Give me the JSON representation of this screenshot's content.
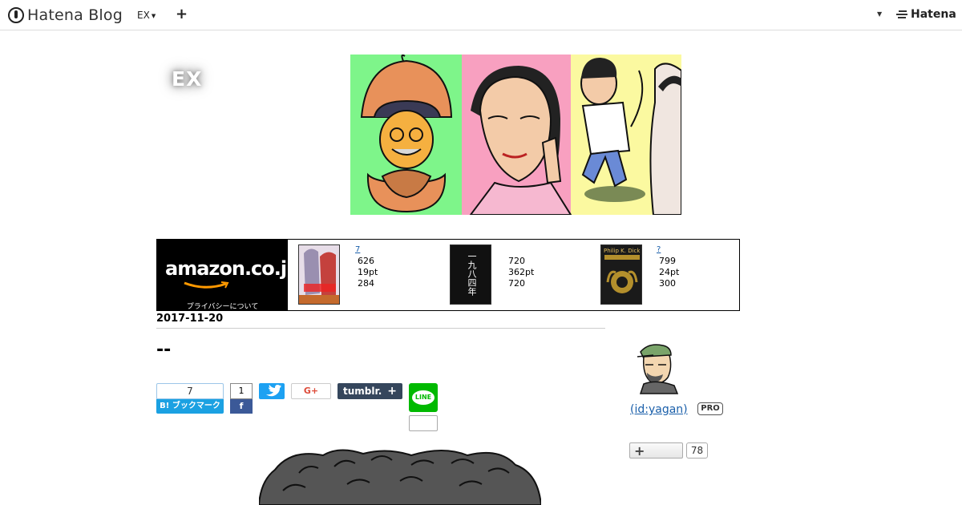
{
  "global_header": {
    "logo_text": "Hatena Blog",
    "blog_selector_label": "EX",
    "new_entry_label": "+",
    "right_menu_caret": "▾",
    "hatena_logo_text": "Hatena"
  },
  "blog": {
    "title": "EX"
  },
  "amazon_widget": {
    "logo_text": "amazon.co.jp",
    "privacy_text": "プライバシーについて",
    "items": [
      {
        "link": "7",
        "lines": [
          "626",
          "19pt",
          "284"
        ]
      },
      {
        "link": "",
        "lines": [
          "720",
          "362pt",
          "720"
        ]
      },
      {
        "link": "?",
        "lines": [
          "799",
          "24pt",
          "300"
        ]
      }
    ],
    "covers": [
      {
        "title": "",
        "color": "#d8c7d8"
      },
      {
        "title": "一九八四年",
        "color": "#111111"
      },
      {
        "title": "Philip K. Dick",
        "color": "#1a1a1a"
      }
    ]
  },
  "entry": {
    "date": "2017-11-20",
    "title": "--"
  },
  "share": {
    "hatena_count": "7",
    "hatena_label": "B! ブックマーク",
    "facebook_count": "1",
    "facebook_label": "f",
    "google_label": "G+",
    "tumblr_label": "tumblr.",
    "tumblr_plus": "+",
    "line_label": "LINE"
  },
  "sidebar": {
    "profile_name": " (id:yagan)",
    "pro_badge": "PRO",
    "follow_label": "+",
    "follow_count": "78"
  },
  "colors": {
    "hatena_blue": "#1ba1e2",
    "facebook_blue": "#3b5998",
    "twitter_blue": "#1da1f2",
    "tumblr_navy": "#35465c",
    "line_green": "#00b900",
    "link_blue": "#1a5faa"
  }
}
